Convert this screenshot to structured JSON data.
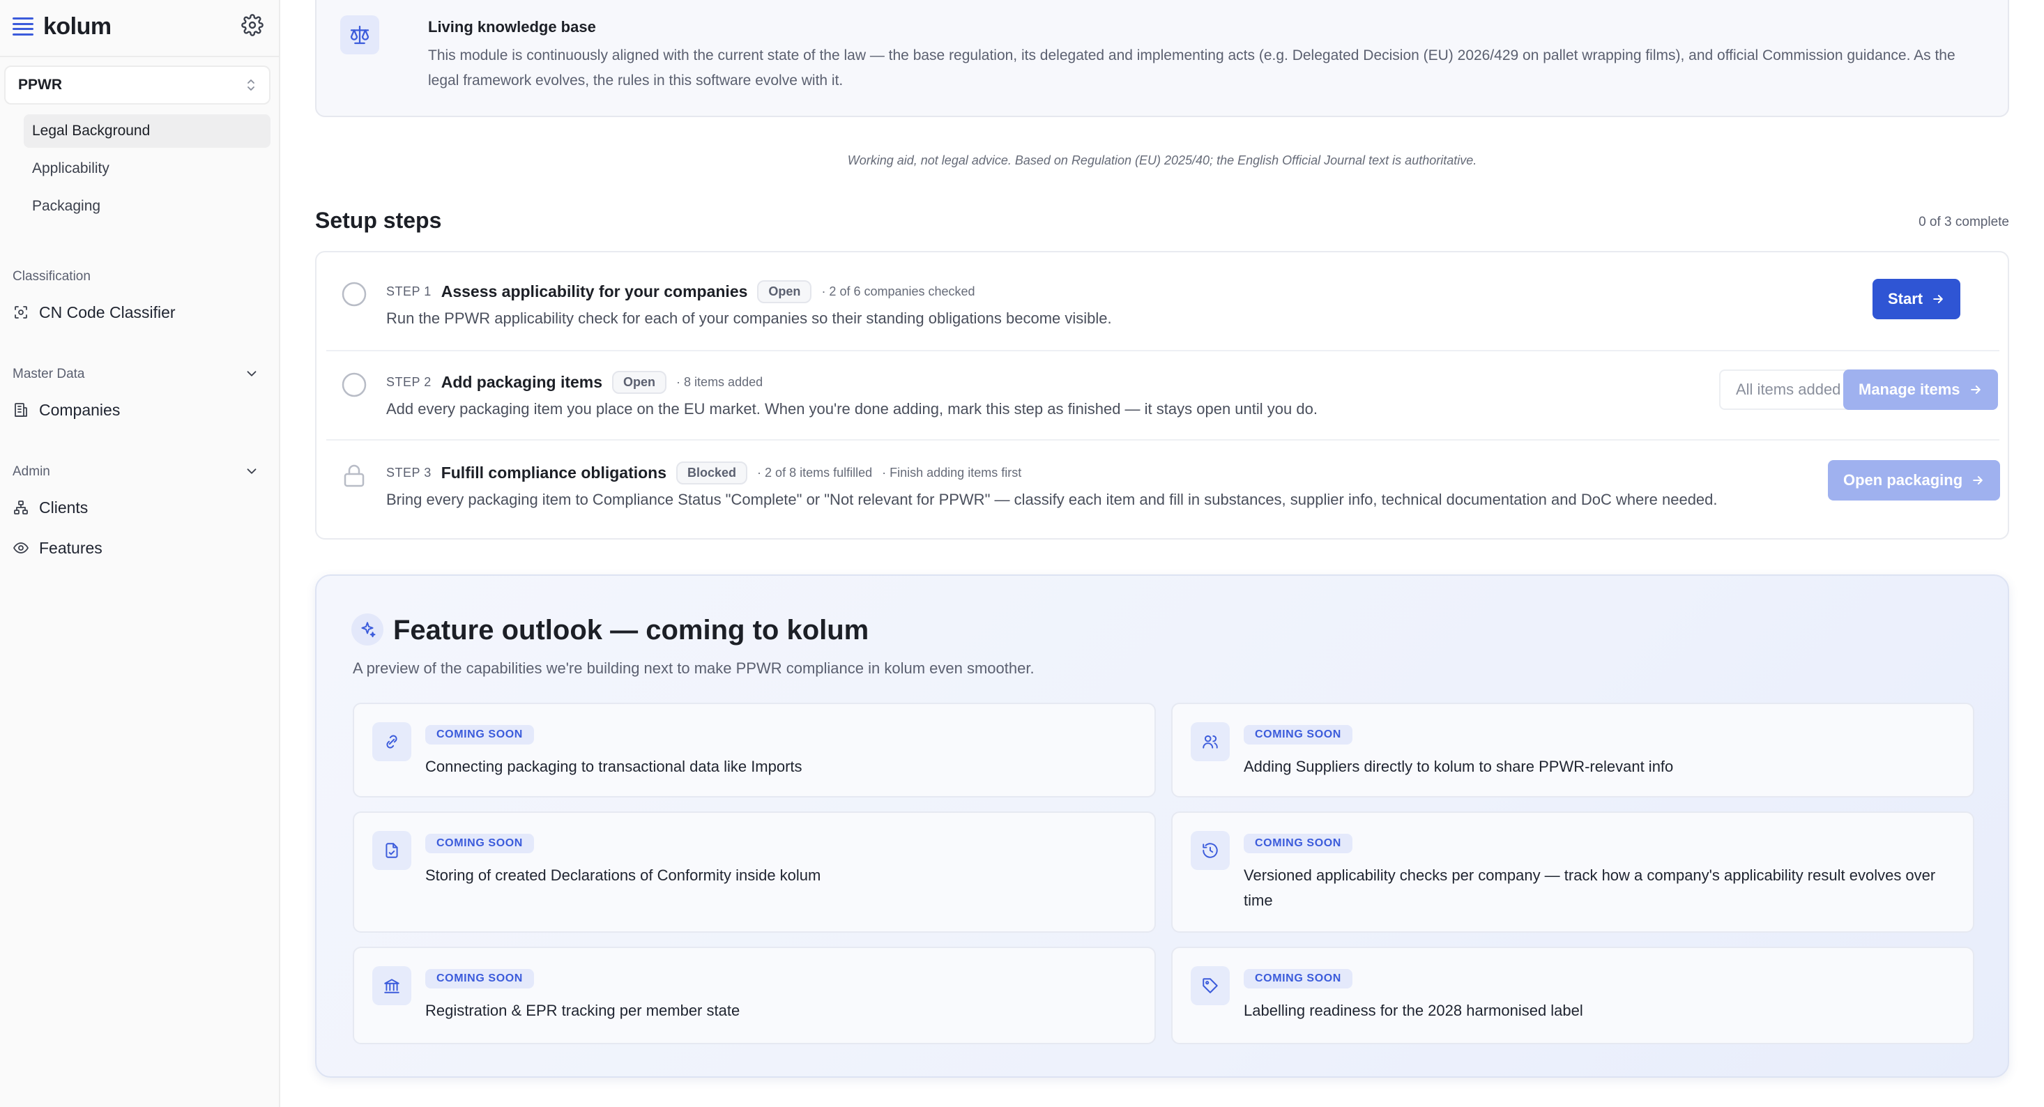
{
  "brand": {
    "name": "kolum"
  },
  "colors": {
    "accent": "#2f55d4",
    "accent_soft": "#9fb1ef",
    "badge_bg": "#e4e9fb"
  },
  "sidebar": {
    "module": "PPWR",
    "subnav": [
      {
        "label": "Legal Background",
        "active": true
      },
      {
        "label": "Applicability",
        "active": false
      },
      {
        "label": "Packaging",
        "active": false
      }
    ],
    "sections": {
      "classification": {
        "label": "Classification",
        "items": [
          {
            "label": "CN Code Classifier",
            "icon": "scan-icon"
          }
        ]
      },
      "master_data": {
        "label": "Master Data",
        "items": [
          {
            "label": "Companies",
            "icon": "building-icon"
          }
        ]
      },
      "admin": {
        "label": "Admin",
        "items": [
          {
            "label": "Clients",
            "icon": "network-icon"
          },
          {
            "label": "Features",
            "icon": "eye-icon"
          }
        ]
      }
    }
  },
  "knowledge": {
    "title": "Living knowledge base",
    "text": "This module is continuously aligned with the current state of the law — the base regulation, its delegated and implementing acts (e.g. Delegated Decision (EU) 2026/429 on pallet wrapping films), and official Commission guidance. As the legal framework evolves, the rules in this software evolve with it."
  },
  "disclaimer": "Working aid, not legal advice. Based on Regulation (EU) 2025/40; the English Official Journal text is authoritative.",
  "setup": {
    "title": "Setup steps",
    "progress": "0 of 3 complete",
    "steps": [
      {
        "num": "STEP 1",
        "title": "Assess applicability for your companies",
        "badge": "Open",
        "meta": "· 2 of 6 companies checked",
        "desc": "Run the PPWR applicability check for each of your companies so their standing obligations become visible.",
        "primary": "Start"
      },
      {
        "num": "STEP 2",
        "title": "Add packaging items",
        "badge": "Open",
        "meta": "· 8 items added",
        "desc": "Add every packaging item you place on the EU market. When you're done adding, mark this step as finished — it stays open until you do.",
        "secondary": "All items added",
        "primary": "Manage items"
      },
      {
        "num": "STEP 3",
        "title": "Fulfill compliance obligations",
        "badge": "Blocked",
        "meta": "· 2 of 8 items fulfilled",
        "meta2": "· Finish adding items first",
        "desc": "Bring every packaging item to Compliance Status \"Complete\" or \"Not relevant for PPWR\" — classify each item and fill in substances, supplier info, technical documentation and DoC where needed.",
        "primary": "Open packaging"
      }
    ]
  },
  "outlook": {
    "title": "Feature outlook — coming to kolum",
    "subtitle": "A preview of the capabilities we're building next to make PPWR compliance in kolum even smoother.",
    "features": [
      {
        "badge": "COMING SOON",
        "text": "Connecting packaging to transactional data like Imports",
        "icon": "link-icon"
      },
      {
        "badge": "COMING SOON",
        "text": "Adding Suppliers directly to kolum to share PPWR-relevant info",
        "icon": "users-icon"
      },
      {
        "badge": "COMING SOON",
        "text": "Storing of created Declarations of Conformity inside kolum",
        "icon": "document-icon"
      },
      {
        "badge": "COMING SOON",
        "text": "Versioned applicability checks per company — track how a company's applicability result evolves over time",
        "icon": "history-icon"
      },
      {
        "badge": "COMING SOON",
        "text": "Registration & EPR tracking per member state",
        "icon": "bank-icon"
      },
      {
        "badge": "COMING SOON",
        "text": "Labelling readiness for the 2028 harmonised label",
        "icon": "tag-icon"
      }
    ]
  }
}
